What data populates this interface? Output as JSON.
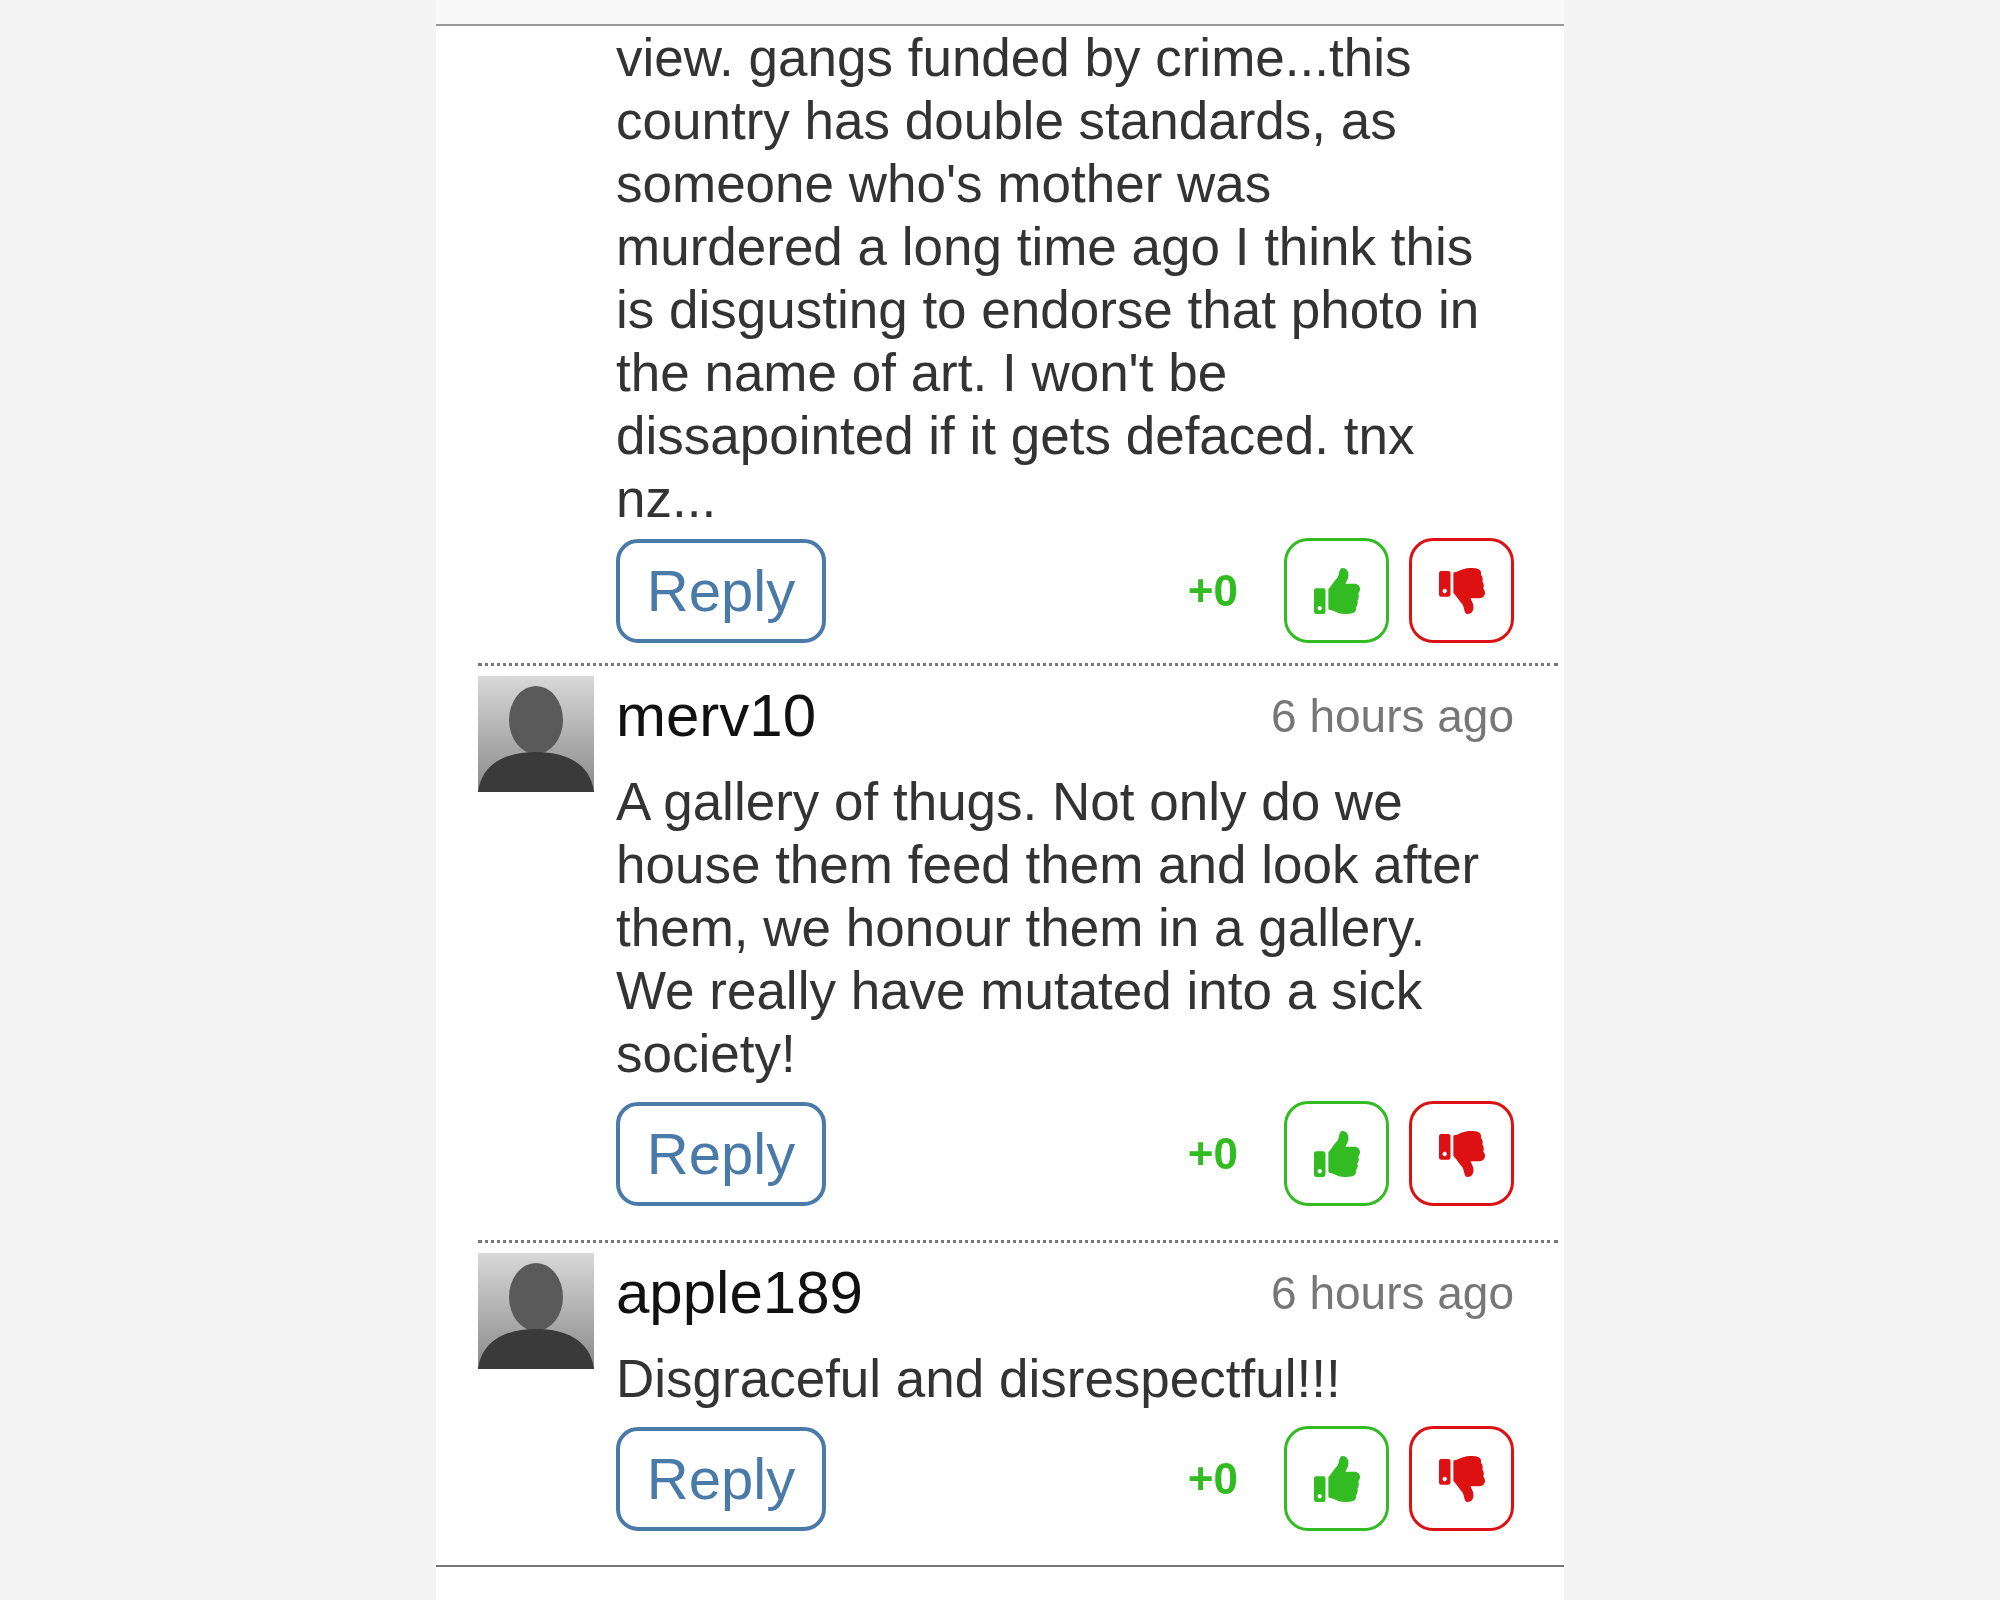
{
  "comments": [
    {
      "body_lines": [
        "view. gangs funded by crime...this",
        "country has double standards, as",
        "someone who's mother was",
        "murdered a long time ago I think this",
        "is disgusting to endorse that photo in",
        "the name of art. I won't be",
        "dissapointed if it gets defaced. tnx",
        "nz..."
      ],
      "reply": "Reply",
      "score": "+0"
    },
    {
      "author": "merv10",
      "time": "6 hours ago",
      "body_lines": [
        "A gallery of thugs. Not only do we",
        "house them feed them and look after",
        "them, we honour them in a gallery.",
        "We really have mutated into a sick",
        "society!"
      ],
      "reply": "Reply",
      "score": "+0"
    },
    {
      "author": "apple189",
      "time": "6 hours ago",
      "body_lines": [
        "Disgraceful and disrespectful!!!"
      ],
      "reply": "Reply",
      "score": "+0"
    }
  ]
}
